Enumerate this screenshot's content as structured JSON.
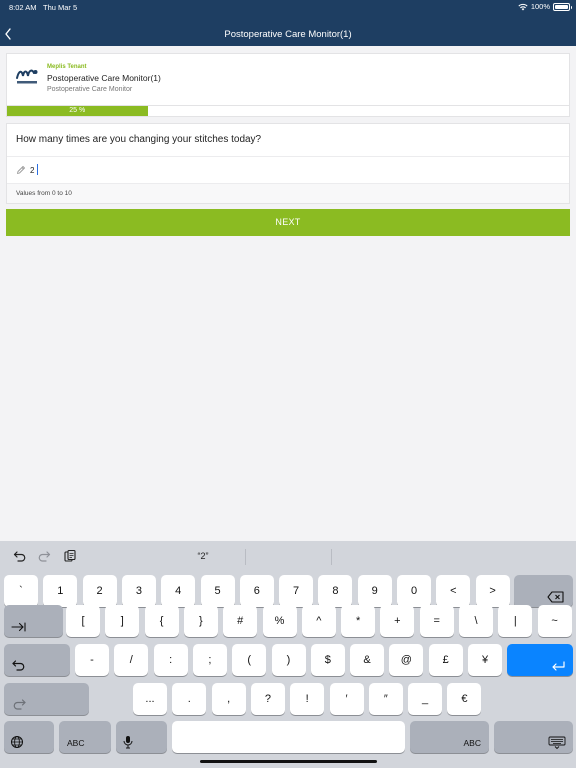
{
  "status_bar": {
    "time": "8:02 AM",
    "date": "Thu Mar 5",
    "battery": "100%"
  },
  "header": {
    "title": "Postoperative Care Monitor(1)"
  },
  "survey": {
    "tenant": "Meplis Tenant",
    "title": "Postoperative Care Monitor(1)",
    "subtitle": "Postoperative Care Monitor",
    "progress_value": 25,
    "progress_label": "25 %"
  },
  "question": {
    "text": "How many times are you changing your stitches today?",
    "answer": "2",
    "hint": "Values from 0 to 10"
  },
  "actions": {
    "next_label": "NEXT"
  },
  "keyboard": {
    "suggestion": "“2”",
    "row1": [
      "`",
      "1",
      "2",
      "3",
      "4",
      "5",
      "6",
      "7",
      "8",
      "9",
      "0",
      "<",
      ">"
    ],
    "row2": [
      "[",
      "]",
      "{",
      "}",
      "#",
      "%",
      "^",
      "*",
      "+",
      "=",
      "\\",
      "|",
      "~"
    ],
    "row3": [
      "-",
      "/",
      ":",
      ";",
      "(",
      ")",
      "$",
      "&",
      "@",
      "£",
      "¥"
    ],
    "row4": [
      "...",
      ".",
      ",",
      "?",
      "!",
      "′",
      "″",
      "_",
      "€"
    ],
    "abc_left": "ABC",
    "abc_right": "ABC"
  },
  "colors": {
    "header": "#1e3e62",
    "accent": "#8bbb22",
    "return_key": "#0a84ff"
  }
}
